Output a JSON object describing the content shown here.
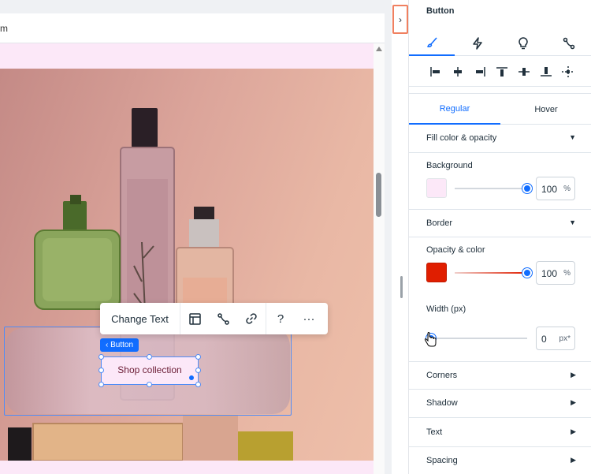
{
  "urlbar": {
    "text": "m"
  },
  "canvas": {
    "button_tag": "‹ Button",
    "shop_button": "Shop collection"
  },
  "toolbar": {
    "change_text": "Change Text",
    "help": "?",
    "more": "···"
  },
  "panel": {
    "title": "Button",
    "collapse_icon": "›",
    "tabs": [
      {
        "name": "design-tab",
        "icon": "brush"
      },
      {
        "name": "interactions-tab",
        "icon": "lightning"
      },
      {
        "name": "tips-tab",
        "icon": "lightbulb"
      },
      {
        "name": "connect-tab",
        "icon": "connect"
      }
    ],
    "state_tabs": {
      "regular": "Regular",
      "hover": "Hover"
    },
    "fill": {
      "header": "Fill color & opacity",
      "background_label": "Background",
      "background_color": "#fce8f8",
      "opacity": "100",
      "unit": "%"
    },
    "border": {
      "header": "Border",
      "opacity_label": "Opacity & color",
      "color": "#e01e00",
      "opacity": "100",
      "unit": "%",
      "width_label": "Width (px)",
      "width": "0",
      "width_unit": "px*"
    },
    "sections": {
      "corners": "Corners",
      "shadow": "Shadow",
      "text": "Text",
      "spacing": "Spacing"
    }
  },
  "colors": {
    "accent": "#116dff",
    "highlight": "#f08060"
  }
}
